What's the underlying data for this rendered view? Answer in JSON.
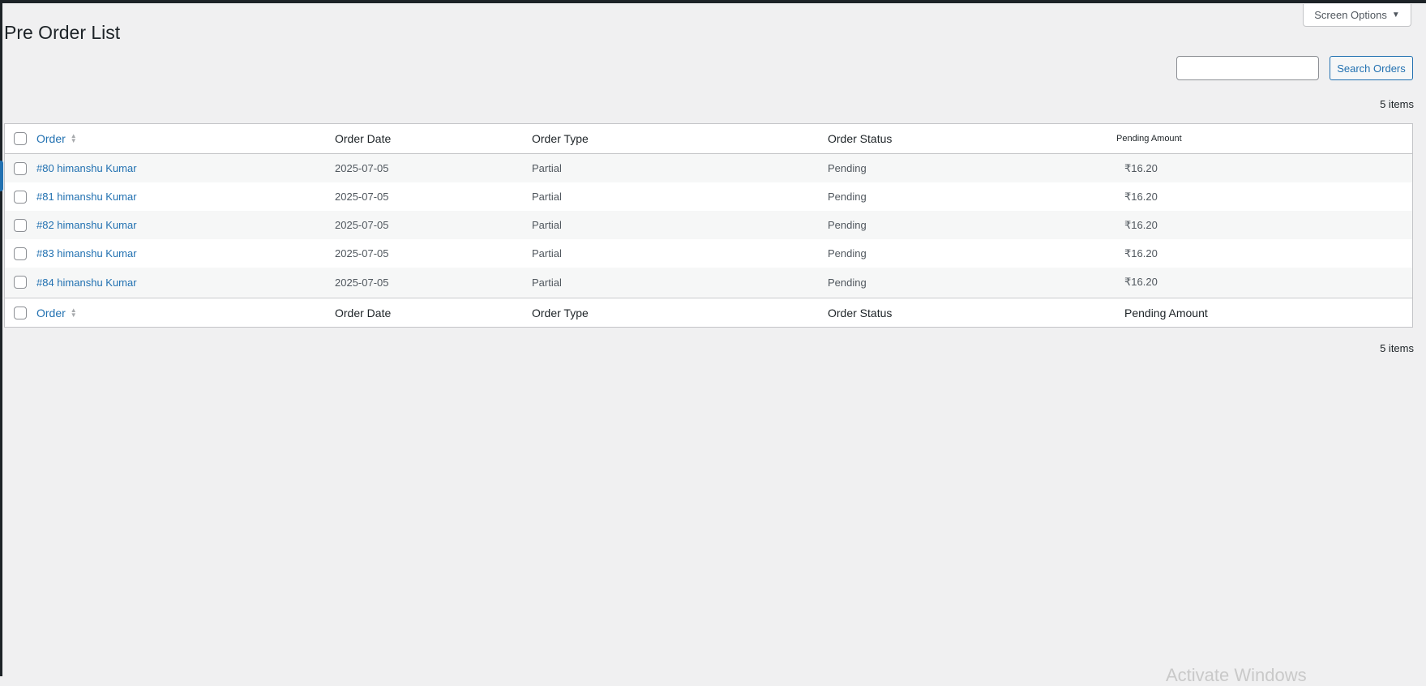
{
  "screen_options": {
    "label": "Screen Options"
  },
  "page": {
    "title": "Pre Order List"
  },
  "search": {
    "value": "",
    "button_label": "Search Orders"
  },
  "items_count": "5 items",
  "table": {
    "columns": [
      "Order",
      "Order Date",
      "Order Type",
      "Order Status",
      "Pending Amount"
    ],
    "rows": [
      {
        "order": "#80 himanshu Kumar",
        "date": "2025-07-05",
        "type": "Partial",
        "status": "Pending",
        "amount": "₹16.20"
      },
      {
        "order": "#81 himanshu Kumar",
        "date": "2025-07-05",
        "type": "Partial",
        "status": "Pending",
        "amount": "₹16.20"
      },
      {
        "order": "#82 himanshu Kumar",
        "date": "2025-07-05",
        "type": "Partial",
        "status": "Pending",
        "amount": "₹16.20"
      },
      {
        "order": "#83 himanshu Kumar",
        "date": "2025-07-05",
        "type": "Partial",
        "status": "Pending",
        "amount": "₹16.20"
      },
      {
        "order": "#84 himanshu Kumar",
        "date": "2025-07-05",
        "type": "Partial",
        "status": "Pending",
        "amount": "₹16.20"
      }
    ]
  },
  "watermark": "Activate Windows",
  "colors": {
    "link": "#2271b1",
    "background": "#f0f0f1",
    "stripe": "#f6f7f7"
  }
}
